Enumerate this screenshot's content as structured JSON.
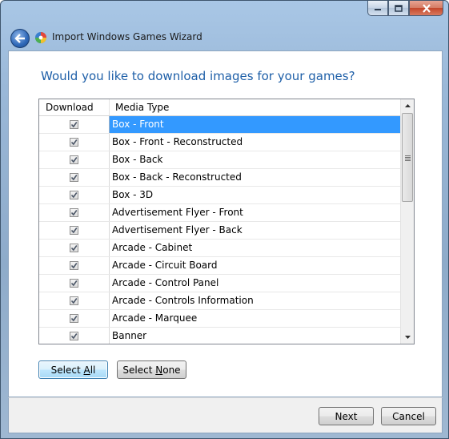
{
  "window": {
    "title": "Import Windows Games Wizard"
  },
  "heading": "Would you like to download images for your games?",
  "grid": {
    "columns": [
      "Download",
      "Media Type"
    ],
    "rows": [
      {
        "checked": true,
        "label": "Box - Front",
        "selected": true
      },
      {
        "checked": true,
        "label": "Box - Front - Reconstructed"
      },
      {
        "checked": true,
        "label": "Box - Back"
      },
      {
        "checked": true,
        "label": "Box - Back - Reconstructed"
      },
      {
        "checked": true,
        "label": "Box - 3D"
      },
      {
        "checked": true,
        "label": "Advertisement Flyer - Front"
      },
      {
        "checked": true,
        "label": "Advertisement Flyer - Back"
      },
      {
        "checked": true,
        "label": "Arcade - Cabinet"
      },
      {
        "checked": true,
        "label": "Arcade - Circuit Board"
      },
      {
        "checked": true,
        "label": "Arcade - Control Panel"
      },
      {
        "checked": true,
        "label": "Arcade - Controls Information"
      },
      {
        "checked": true,
        "label": "Arcade - Marquee"
      },
      {
        "checked": true,
        "label": "Banner"
      }
    ]
  },
  "buttons": {
    "select_all_pre": "Select ",
    "select_all_accel": "A",
    "select_all_post": "ll",
    "select_none_pre": "Select ",
    "select_none_accel": "N",
    "select_none_post": "one",
    "next": "Next",
    "cancel": "Cancel"
  },
  "colors": {
    "heading": "#1e5fa8",
    "selection": "#3399ff"
  }
}
